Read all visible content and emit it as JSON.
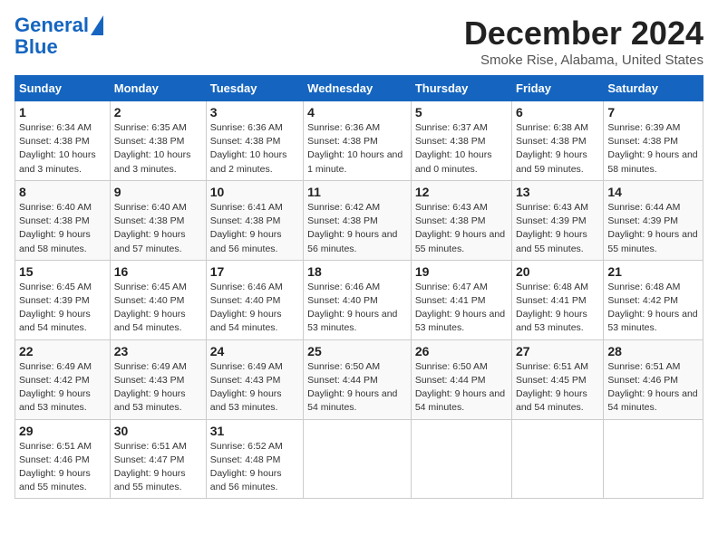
{
  "logo": {
    "line1": "General",
    "line2": "Blue"
  },
  "title": "December 2024",
  "subtitle": "Smoke Rise, Alabama, United States",
  "days_of_week": [
    "Sunday",
    "Monday",
    "Tuesday",
    "Wednesday",
    "Thursday",
    "Friday",
    "Saturday"
  ],
  "weeks": [
    [
      {
        "day": "1",
        "sunrise": "6:34 AM",
        "sunset": "4:38 PM",
        "daylight": "10 hours and 3 minutes."
      },
      {
        "day": "2",
        "sunrise": "6:35 AM",
        "sunset": "4:38 PM",
        "daylight": "10 hours and 3 minutes."
      },
      {
        "day": "3",
        "sunrise": "6:36 AM",
        "sunset": "4:38 PM",
        "daylight": "10 hours and 2 minutes."
      },
      {
        "day": "4",
        "sunrise": "6:36 AM",
        "sunset": "4:38 PM",
        "daylight": "10 hours and 1 minute."
      },
      {
        "day": "5",
        "sunrise": "6:37 AM",
        "sunset": "4:38 PM",
        "daylight": "10 hours and 0 minutes."
      },
      {
        "day": "6",
        "sunrise": "6:38 AM",
        "sunset": "4:38 PM",
        "daylight": "9 hours and 59 minutes."
      },
      {
        "day": "7",
        "sunrise": "6:39 AM",
        "sunset": "4:38 PM",
        "daylight": "9 hours and 58 minutes."
      }
    ],
    [
      {
        "day": "8",
        "sunrise": "6:40 AM",
        "sunset": "4:38 PM",
        "daylight": "9 hours and 58 minutes."
      },
      {
        "day": "9",
        "sunrise": "6:40 AM",
        "sunset": "4:38 PM",
        "daylight": "9 hours and 57 minutes."
      },
      {
        "day": "10",
        "sunrise": "6:41 AM",
        "sunset": "4:38 PM",
        "daylight": "9 hours and 56 minutes."
      },
      {
        "day": "11",
        "sunrise": "6:42 AM",
        "sunset": "4:38 PM",
        "daylight": "9 hours and 56 minutes."
      },
      {
        "day": "12",
        "sunrise": "6:43 AM",
        "sunset": "4:38 PM",
        "daylight": "9 hours and 55 minutes."
      },
      {
        "day": "13",
        "sunrise": "6:43 AM",
        "sunset": "4:39 PM",
        "daylight": "9 hours and 55 minutes."
      },
      {
        "day": "14",
        "sunrise": "6:44 AM",
        "sunset": "4:39 PM",
        "daylight": "9 hours and 55 minutes."
      }
    ],
    [
      {
        "day": "15",
        "sunrise": "6:45 AM",
        "sunset": "4:39 PM",
        "daylight": "9 hours and 54 minutes."
      },
      {
        "day": "16",
        "sunrise": "6:45 AM",
        "sunset": "4:40 PM",
        "daylight": "9 hours and 54 minutes."
      },
      {
        "day": "17",
        "sunrise": "6:46 AM",
        "sunset": "4:40 PM",
        "daylight": "9 hours and 54 minutes."
      },
      {
        "day": "18",
        "sunrise": "6:46 AM",
        "sunset": "4:40 PM",
        "daylight": "9 hours and 53 minutes."
      },
      {
        "day": "19",
        "sunrise": "6:47 AM",
        "sunset": "4:41 PM",
        "daylight": "9 hours and 53 minutes."
      },
      {
        "day": "20",
        "sunrise": "6:48 AM",
        "sunset": "4:41 PM",
        "daylight": "9 hours and 53 minutes."
      },
      {
        "day": "21",
        "sunrise": "6:48 AM",
        "sunset": "4:42 PM",
        "daylight": "9 hours and 53 minutes."
      }
    ],
    [
      {
        "day": "22",
        "sunrise": "6:49 AM",
        "sunset": "4:42 PM",
        "daylight": "9 hours and 53 minutes."
      },
      {
        "day": "23",
        "sunrise": "6:49 AM",
        "sunset": "4:43 PM",
        "daylight": "9 hours and 53 minutes."
      },
      {
        "day": "24",
        "sunrise": "6:49 AM",
        "sunset": "4:43 PM",
        "daylight": "9 hours and 53 minutes."
      },
      {
        "day": "25",
        "sunrise": "6:50 AM",
        "sunset": "4:44 PM",
        "daylight": "9 hours and 54 minutes."
      },
      {
        "day": "26",
        "sunrise": "6:50 AM",
        "sunset": "4:44 PM",
        "daylight": "9 hours and 54 minutes."
      },
      {
        "day": "27",
        "sunrise": "6:51 AM",
        "sunset": "4:45 PM",
        "daylight": "9 hours and 54 minutes."
      },
      {
        "day": "28",
        "sunrise": "6:51 AM",
        "sunset": "4:46 PM",
        "daylight": "9 hours and 54 minutes."
      }
    ],
    [
      {
        "day": "29",
        "sunrise": "6:51 AM",
        "sunset": "4:46 PM",
        "daylight": "9 hours and 55 minutes."
      },
      {
        "day": "30",
        "sunrise": "6:51 AM",
        "sunset": "4:47 PM",
        "daylight": "9 hours and 55 minutes."
      },
      {
        "day": "31",
        "sunrise": "6:52 AM",
        "sunset": "4:48 PM",
        "daylight": "9 hours and 56 minutes."
      },
      null,
      null,
      null,
      null
    ]
  ]
}
